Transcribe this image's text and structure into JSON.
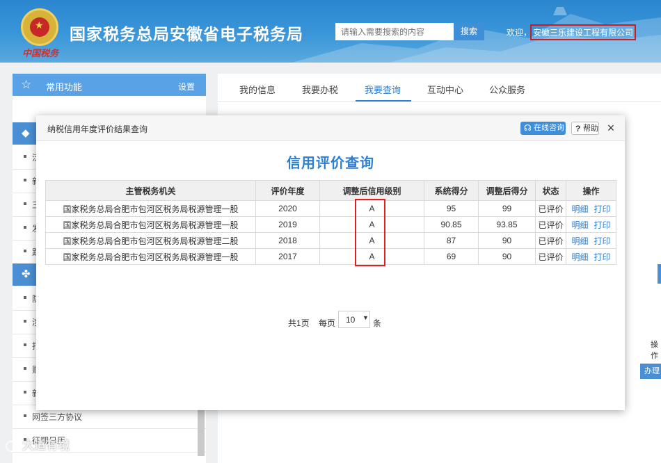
{
  "header": {
    "brand_script": "中国税务",
    "site_title": "国家税务总局安徽省电子税务局",
    "search_placeholder": "请输入需要搜索的内容",
    "search_button": "搜索",
    "welcome": "欢迎，",
    "company": "安徽三乐建设工程有限公司"
  },
  "sidebar": {
    "title": "常用功能",
    "setting": "设置",
    "items": [
      {
        "label": "泛"
      },
      {
        "label": "新"
      },
      {
        "label": "三"
      },
      {
        "label": "发"
      },
      {
        "label": "跟"
      },
      {
        "label": "防"
      },
      {
        "label": "涉"
      },
      {
        "label": "打"
      },
      {
        "label": "财"
      },
      {
        "label": "新"
      },
      {
        "label": "网签三方协议"
      },
      {
        "label": "征期日历"
      }
    ]
  },
  "tabs": [
    "我的信息",
    "我要办税",
    "我要查询",
    "互动中心",
    "公众服务"
  ],
  "main_right": {
    "operation_text": "操作",
    "button_text": "办理"
  },
  "modal": {
    "title": "纳税信用年度评价结果查询",
    "online_button": "在线咨询",
    "help_button": "帮助",
    "close": "×",
    "heading": "信用评价查询",
    "columns": [
      "主管税务机关",
      "评价年度",
      "调整后信用级别",
      "系统得分",
      "调整后得分",
      "状态",
      "操作"
    ],
    "rows": [
      {
        "org": "国家税务总局合肥市包河区税务局税源管理一股",
        "year": "2020",
        "level": "A",
        "score": "95",
        "adj_score": "99",
        "status": "已评价",
        "op1": "明细",
        "op2": "打印"
      },
      {
        "org": "国家税务总局合肥市包河区税务局税源管理一股",
        "year": "2019",
        "level": "A",
        "score": "90.85",
        "adj_score": "93.85",
        "status": "已评价",
        "op1": "明细",
        "op2": "打印"
      },
      {
        "org": "国家税务总局合肥市包河区税务局税源管理二股",
        "year": "2018",
        "level": "A",
        "score": "87",
        "adj_score": "90",
        "status": "已评价",
        "op1": "明细",
        "op2": "打印"
      },
      {
        "org": "国家税务总局合肥市包河区税务局税源管理一股",
        "year": "2017",
        "level": "A",
        "score": "69",
        "adj_score": "90",
        "status": "已评价",
        "op1": "明细",
        "op2": "打印"
      }
    ],
    "pager": {
      "total": "共1页",
      "per_page_label": "每页",
      "per_page_value": "10",
      "unit": "条"
    }
  },
  "watermark": "大道有境",
  "colors": {
    "accent": "#2f7fd2",
    "status": "#e02020",
    "highlight": "#d01b1b",
    "header": "#2b86cf"
  }
}
